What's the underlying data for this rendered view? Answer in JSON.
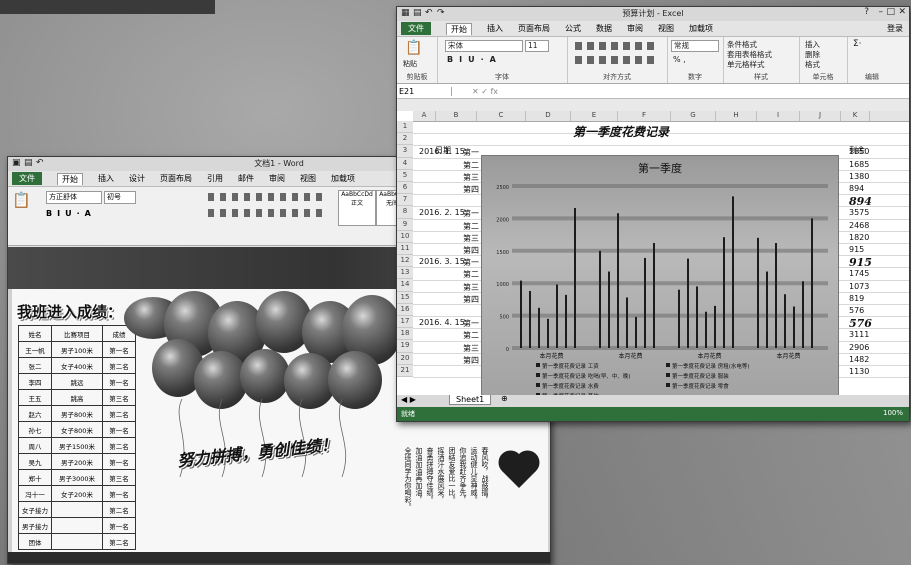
{
  "excel": {
    "title": "预算计划 - Excel",
    "login": "登录",
    "menu": [
      "文件",
      "开始",
      "插入",
      "页面布局",
      "公式",
      "数据",
      "审阅",
      "视图",
      "加载项"
    ],
    "ribbon": {
      "paste": "粘贴",
      "clipboard": "剪贴板",
      "font_name": "宋体",
      "font_size": "11",
      "font_group": "字体",
      "align_group": "对齐方式",
      "number_format": "常规",
      "number_group": "数字",
      "cond_format": "条件格式",
      "table_format": "套用表格格式",
      "cell_style": "单元格样式",
      "styles_group": "样式",
      "insert": "插入",
      "delete": "删除",
      "format": "格式",
      "cells_group": "单元格",
      "editing_group": "编辑"
    },
    "name_box": "E21",
    "columns": [
      "A",
      "B",
      "C",
      "D",
      "E",
      "F",
      "G",
      "H",
      "I",
      "J",
      "K"
    ],
    "rows": [
      "1",
      "2",
      "3",
      "4",
      "5",
      "6",
      "7",
      "8",
      "9",
      "10",
      "11",
      "12",
      "13",
      "14",
      "15",
      "16",
      "17",
      "18",
      "19",
      "20",
      "21"
    ],
    "sheet_title": "第一季度花费记录",
    "date_header": "日期",
    "balance_header": "剩余",
    "dates": [
      "2016. 1. 15",
      "2016. 2. 15",
      "2016. 3. 15",
      "2016. 4. 15"
    ],
    "weeks": [
      "第一",
      "第二",
      "第三",
      "第四"
    ],
    "balances": [
      "1850",
      "1685",
      "1380",
      "894",
      "894",
      "3575",
      "2468",
      "1820",
      "915",
      "915",
      "1745",
      "1073",
      "819",
      "576",
      "576",
      "3111",
      "2906",
      "1482",
      "1130"
    ],
    "sheet_tab": "Sheet1",
    "status": "就绪",
    "zoom": "100%"
  },
  "chart_data": {
    "type": "bar",
    "title": "第一季度",
    "categories": [
      "本月花费",
      "本月花费",
      "本月花费",
      "本月花费"
    ],
    "ylim": [
      0,
      2500
    ],
    "yticks": [
      "0",
      "500",
      "1000",
      "1500",
      "2000",
      "2500"
    ],
    "series": [
      {
        "name": "第一季度花费记录 工资",
        "values": [
          1040,
          1500,
          900,
          1700
        ]
      },
      {
        "name": "第一季度花费记录 房租(水电等)",
        "values": [
          880,
          1180,
          1380,
          1180
        ]
      },
      {
        "name": "第一季度花费记录 吃喝(早、中、晚)",
        "values": [
          620,
          2080,
          950,
          1620
        ]
      },
      {
        "name": "第一季度花费记录 服装",
        "values": [
          450,
          780,
          560,
          830
        ]
      },
      {
        "name": "第一季度花费记录 水费",
        "values": [
          980,
          480,
          650,
          640
        ]
      },
      {
        "name": "第一季度花费记录 零食",
        "values": [
          820,
          1390,
          1710,
          1030
        ]
      },
      {
        "name": "第一季度花费记录 其他",
        "values": [
          2160,
          1620,
          2340,
          2000
        ]
      }
    ],
    "legend": [
      "第一季度花费记录 工资",
      "第一季度花费记录 房租(水电等)",
      "第一季度花费记录 吃喝(早、中、晚)",
      "第一季度花费记录 服装",
      "第一季度花费记录 水费",
      "第一季度花费记录 零食",
      "第一季度花费记录 其他"
    ],
    "legend_position": "bottom"
  },
  "word": {
    "title": "文档1 - Word",
    "menu": [
      "文件",
      "开始",
      "插入",
      "设计",
      "页面布局",
      "引用",
      "邮件",
      "审阅",
      "视图",
      "加载项"
    ],
    "font_name": "方正舒体",
    "font_size": "初号",
    "style1": "AaBbCcDd",
    "style1_label": "正文",
    "style2": "AaBbCcDd",
    "style2_label": "无间隔",
    "banner": "我班进入成绩：",
    "table_rows": [
      [
        "姓名",
        "比赛项目",
        "成绩"
      ],
      [
        "王一帆",
        "男子100米",
        "第一名"
      ],
      [
        "张二",
        "女子400米",
        "第二名"
      ],
      [
        "李四",
        "跳远",
        "第一名"
      ],
      [
        "王五",
        "跳高",
        "第三名"
      ],
      [
        "赵六",
        "男子800米",
        "第二名"
      ],
      [
        "孙七",
        "女子800米",
        "第一名"
      ],
      [
        "周八",
        "男子1500米",
        "第二名"
      ],
      [
        "吴九",
        "男子200米",
        "第一名"
      ],
      [
        "郑十",
        "男子3000米",
        "第三名"
      ],
      [
        "冯十一",
        "女子200米",
        "第一名"
      ],
      [
        "女子接力",
        "",
        "第二名"
      ],
      [
        "男子接力",
        "",
        "第一名"
      ],
      [
        "团体",
        "",
        "第二名"
      ]
    ],
    "slogan": "努力拼搏，勇创佳绩！",
    "vertical_text": [
      "春风吹，战鼓擂，",
      "运动健儿显神威。",
      "你追我赶齐争先，",
      "团结友爱比一比。",
      "挥洒汗水展风采，",
      "奋勇拼搏夺佳绩。",
      "加油加油再加油，",
      "全班同学为你喝彩。"
    ]
  }
}
